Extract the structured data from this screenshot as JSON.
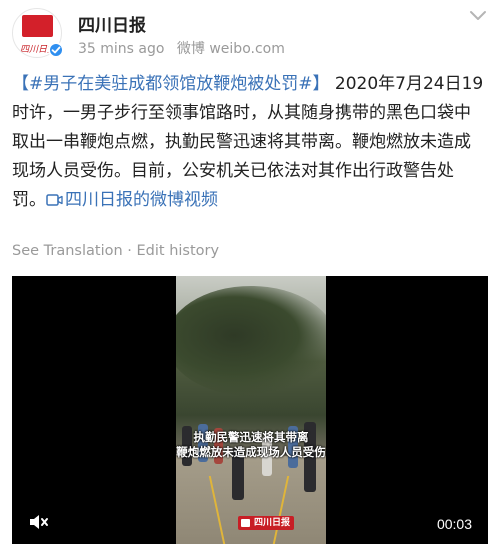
{
  "account": {
    "name": "四川日报",
    "logo_text": "四川日报",
    "time_ago": "35 mins ago",
    "source": "微博 weibo.com"
  },
  "post": {
    "topic": "【#男子在美驻成都领馆放鞭炮被处罚#】",
    "body": " 2020年7月24日19时许，一男子步行至领事馆路时，从其随身携带的黑色口袋中取出一串鞭炮点燃，执勤民警迅速将其带离。鞭炮燃放未造成现场人员受伤。目前，公安机关已依法对其作出行政警告处罚。",
    "video_link": "四川日报的微博视频"
  },
  "actions": {
    "translate": "See Translation",
    "separator": " · ",
    "edit_history": "Edit history"
  },
  "video": {
    "caption_line1": "执勤民警迅速将其带离",
    "caption_line2": "鞭炮燃放未造成现场人员受伤",
    "watermark": "四川日报",
    "duration": "00:03"
  },
  "icons": {
    "more": "chevron-down-icon",
    "verified": "verified-badge-icon",
    "video_link": "video-play-icon",
    "mute": "speaker-muted-icon"
  },
  "colors": {
    "link": "#3a72b7",
    "brand_red": "#d3202a",
    "verified_blue": "#2f8ff0",
    "meta_gray": "#9a9a9a"
  }
}
